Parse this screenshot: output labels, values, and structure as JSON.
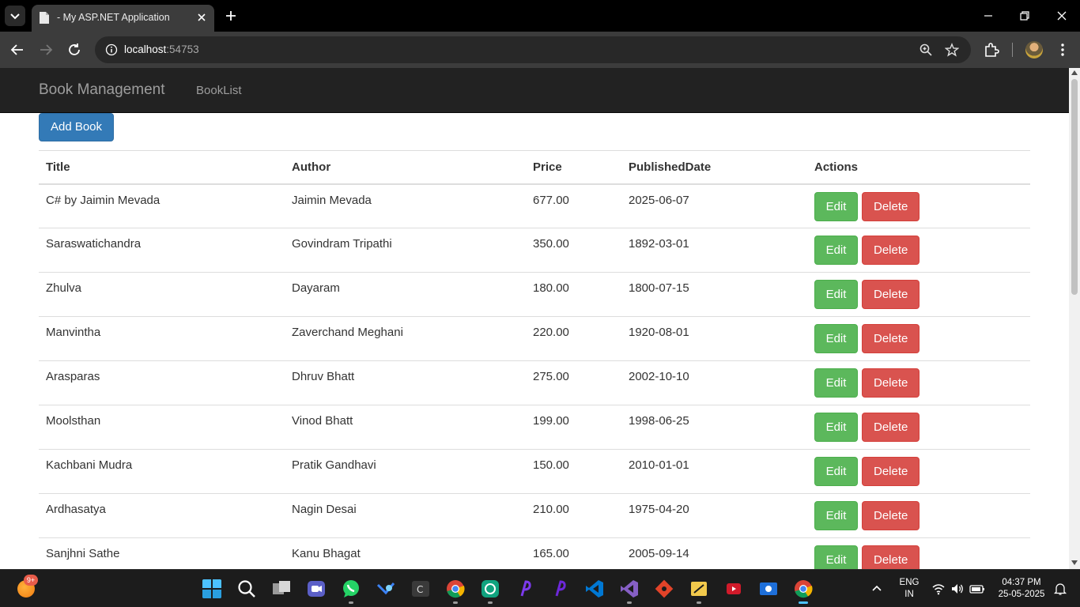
{
  "browser": {
    "tab_title": "- My ASP.NET Application",
    "url_host": "localhost",
    "url_port": ":54753"
  },
  "navbar": {
    "brand": "Book Management",
    "links": [
      "BookList"
    ]
  },
  "page": {
    "add_button": "Add Book",
    "columns": [
      "Title",
      "Author",
      "Price",
      "PublishedDate",
      "Actions"
    ],
    "edit_label": "Edit",
    "delete_label": "Delete",
    "rows": [
      {
        "title": "C# by Jaimin Mevada",
        "author": "Jaimin Mevada",
        "price": "677.00",
        "date": "2025-06-07"
      },
      {
        "title": "Saraswatichandra",
        "author": "Govindram Tripathi",
        "price": "350.00",
        "date": "1892-03-01"
      },
      {
        "title": "Zhulva",
        "author": "Dayaram",
        "price": "180.00",
        "date": "1800-07-15"
      },
      {
        "title": "Manvintha",
        "author": "Zaverchand Meghani",
        "price": "220.00",
        "date": "1920-08-01"
      },
      {
        "title": "Arasparas",
        "author": "Dhruv Bhatt",
        "price": "275.00",
        "date": "2002-10-10"
      },
      {
        "title": "Moolsthan",
        "author": "Vinod Bhatt",
        "price": "199.00",
        "date": "1998-06-25"
      },
      {
        "title": "Kachbani Mudra",
        "author": "Pratik Gandhavi",
        "price": "150.00",
        "date": "2010-01-01"
      },
      {
        "title": "Ardhasatya",
        "author": "Nagin Desai",
        "price": "210.00",
        "date": "1975-04-20"
      },
      {
        "title": "Sanjhni Sathe",
        "author": "Kanu Bhagat",
        "price": "165.00",
        "date": "2005-09-14"
      }
    ]
  },
  "taskbar": {
    "notification_badge": "9+",
    "language": "ENG",
    "region": "IN",
    "time": "04:37 PM",
    "date": "25-05-2025"
  },
  "colors": {
    "navbar_bg": "#222222",
    "primary": "#337ab7",
    "success": "#5cb85c",
    "danger": "#d9534f"
  }
}
